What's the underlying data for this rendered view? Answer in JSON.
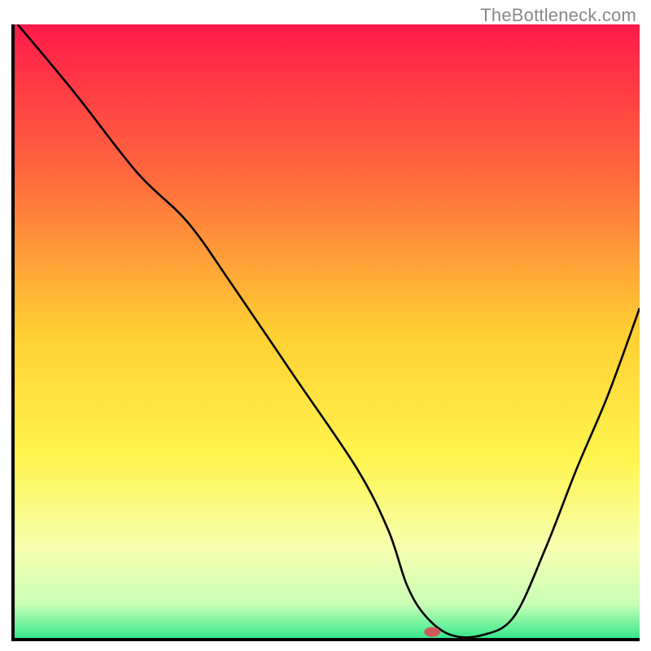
{
  "watermark": "TheBottleneck.com",
  "chart_data": {
    "type": "line",
    "title": "",
    "xlabel": "",
    "ylabel": "",
    "xlim": [
      0,
      100
    ],
    "ylim": [
      0,
      100
    ],
    "grid": false,
    "legend": false,
    "background_gradient": {
      "stops": [
        {
          "offset": 0,
          "color": "#ff1a4a"
        },
        {
          "offset": 25,
          "color": "#ff6b3d"
        },
        {
          "offset": 50,
          "color": "#ffcf33"
        },
        {
          "offset": 70,
          "color": "#fff44d"
        },
        {
          "offset": 85,
          "color": "#f6ffb0"
        },
        {
          "offset": 94,
          "color": "#c9ffb6"
        },
        {
          "offset": 100,
          "color": "#29e68a"
        }
      ]
    },
    "series": [
      {
        "name": "bottleneck-curve",
        "color": "#000000",
        "x": [
          1,
          10,
          20,
          28,
          35,
          45,
          55,
          60,
          63,
          66,
          70,
          75,
          80,
          85,
          90,
          95,
          100
        ],
        "y": [
          100,
          89,
          76,
          68,
          58,
          43,
          28,
          18,
          9,
          4,
          1,
          1,
          4,
          15,
          28,
          40,
          54
        ]
      }
    ],
    "marker": {
      "name": "current-point",
      "x": 67,
      "y": 1.5,
      "color": "#cf5a5a",
      "rx": 10,
      "ry": 6
    },
    "axes": {
      "color": "#000000",
      "width": 4
    }
  }
}
